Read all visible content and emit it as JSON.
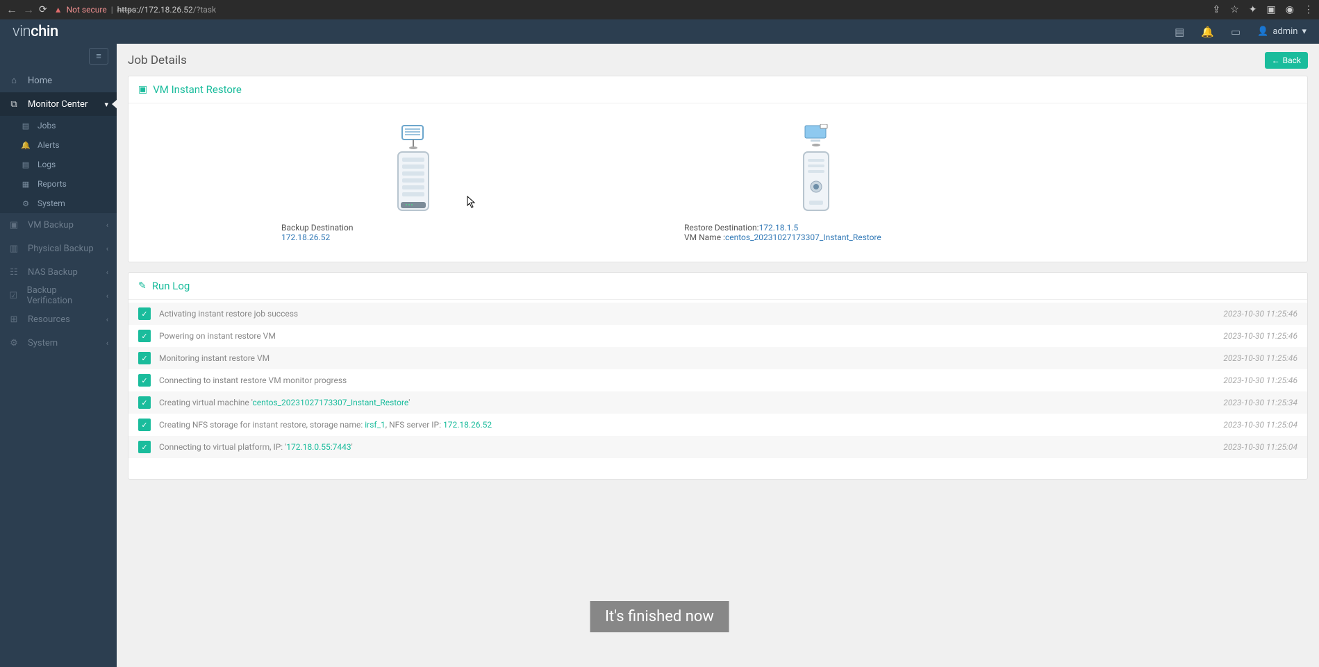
{
  "browser": {
    "not_secure": "Not secure",
    "url_prefix": "https",
    "url_host": "://172.18.26.52",
    "url_path": "/?task"
  },
  "header": {
    "logo_a": "vin",
    "logo_b": "chin",
    "username": "admin"
  },
  "sidebar": {
    "home": "Home",
    "monitor": "Monitor Center",
    "subs": {
      "jobs": "Jobs",
      "alerts": "Alerts",
      "logs": "Logs",
      "reports": "Reports",
      "system": "System"
    },
    "vm_backup": "VM Backup",
    "physical_backup": "Physical Backup",
    "nas_backup": "NAS Backup",
    "backup_verification": "Backup Verification",
    "resources": "Resources",
    "system": "System"
  },
  "page": {
    "title": "Job Details",
    "back": "Back",
    "panel1_title": "VM Instant Restore",
    "panel2_title": "Run Log",
    "backup_dest_label": "Backup Destination",
    "backup_dest_ip": "172.18.26.52",
    "restore_dest_label": "Restore Destination:",
    "restore_dest_ip": "172.18.1.5",
    "vm_name_label": "VM Name :",
    "vm_name": "centos_20231027173307_Instant_Restore"
  },
  "log": [
    {
      "msg": "Activating instant restore job success",
      "ts": "2023-10-30 11:25:46"
    },
    {
      "msg": "Powering on instant restore VM",
      "ts": "2023-10-30 11:25:46"
    },
    {
      "msg": "Monitoring instant restore VM",
      "ts": "2023-10-30 11:25:46"
    },
    {
      "msg": "Connecting to instant restore VM monitor progress",
      "ts": "2023-10-30 11:25:46"
    },
    {
      "msg_a": "Creating virtual machine '",
      "hl": "centos_20231027173307_Instant_Restore",
      "msg_b": "'",
      "ts": "2023-10-30 11:25:34"
    },
    {
      "msg_a": "Creating NFS storage for instant restore, storage name: ",
      "hl": "irsf_1",
      "msg_b": ", NFS server IP: ",
      "hl2": "172.18.26.52",
      "ts": "2023-10-30 11:25:04"
    },
    {
      "msg_a": "Connecting to virtual platform, IP: '",
      "hl": "172.18.0.55:7443",
      "msg_b": "'",
      "ts": "2023-10-30 11:25:04"
    }
  ],
  "toast": "It's finished now"
}
